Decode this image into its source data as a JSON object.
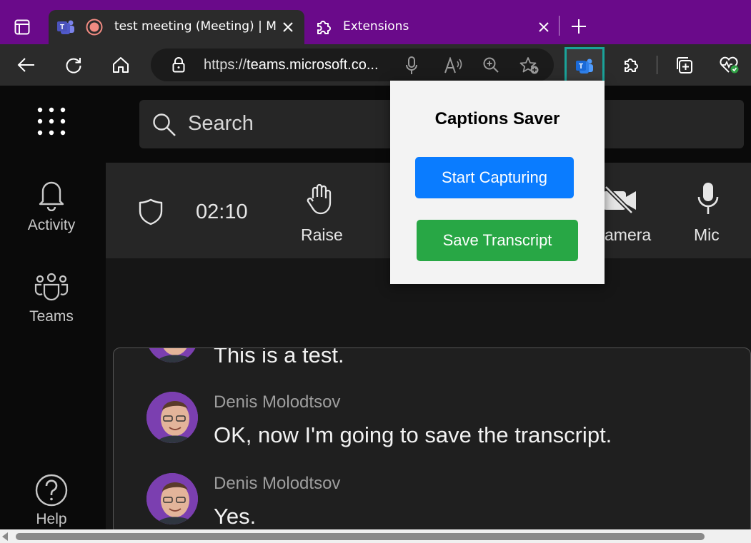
{
  "browser": {
    "tabs": [
      {
        "title": "test meeting (Meeting) | Mic",
        "active": true
      },
      {
        "title": "Extensions",
        "active": false
      }
    ],
    "address": {
      "prefix": "https://",
      "host": "teams.microsoft.co..."
    }
  },
  "teams": {
    "rail": [
      {
        "label": "Activity",
        "icon": "bell-icon"
      },
      {
        "label": "Teams",
        "icon": "teams-icon"
      },
      {
        "label": "Help",
        "icon": "help-icon"
      }
    ],
    "search_placeholder": "Search",
    "meeting": {
      "timer": "02:10",
      "raise_label": "Raise",
      "camera_label": "amera",
      "mic_label": "Mic"
    },
    "captions": [
      {
        "speaker": "",
        "text": "This is a test."
      },
      {
        "speaker": "Denis Molodtsov",
        "text": "OK, now I'm going to save the transcript."
      },
      {
        "speaker": "Denis Molodtsov",
        "text": "Yes."
      }
    ]
  },
  "popup": {
    "title": "Captions Saver",
    "start_label": "Start Capturing",
    "save_label": "Save Transcript"
  },
  "colors": {
    "tabstrip": "#6a0a8a",
    "start_button": "#0a7cff",
    "save_button": "#28a745",
    "extension_highlight": "#1aa39a"
  }
}
